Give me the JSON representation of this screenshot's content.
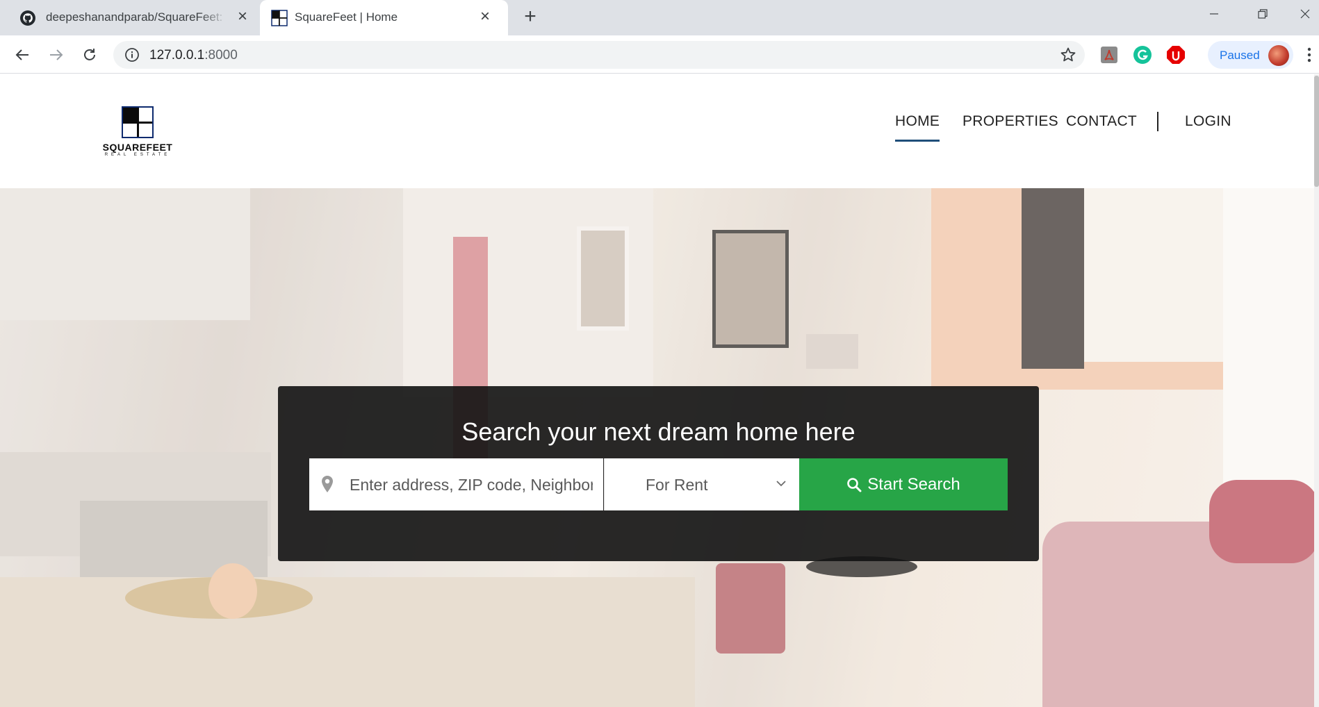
{
  "browser": {
    "tabs": [
      {
        "title": "deepeshanandparab/SquareFeet:",
        "active": false,
        "icon": "github-icon"
      },
      {
        "title": "SquareFeet | Home",
        "active": true,
        "icon": "squarefeet-favicon-icon"
      }
    ],
    "address": {
      "host": "127.0.0.1",
      "port": ":8000"
    },
    "profile_label": "Paused",
    "colors": {
      "tabbar": "#dee1e6",
      "omnibox": "#f1f3f4",
      "paused_bg": "#e8f0fe",
      "paused_text": "#1a73e8"
    }
  },
  "site": {
    "logo": {
      "name": "SQUAREFEET",
      "sub": "REAL ESTATE"
    },
    "nav": {
      "home": "HOME",
      "properties": "PROPERTIES",
      "contact": "CONTACT",
      "login": "LOGIN"
    },
    "colors": {
      "accent": "#1f4e79",
      "search_button": "#27a547",
      "search_panel": "#121212"
    }
  },
  "hero": {
    "headline": "Search your next dream home here",
    "address_placeholder": "Enter address, ZIP code, Neighborhood",
    "listing_type": "For Rent",
    "search_button": "Start Search"
  }
}
